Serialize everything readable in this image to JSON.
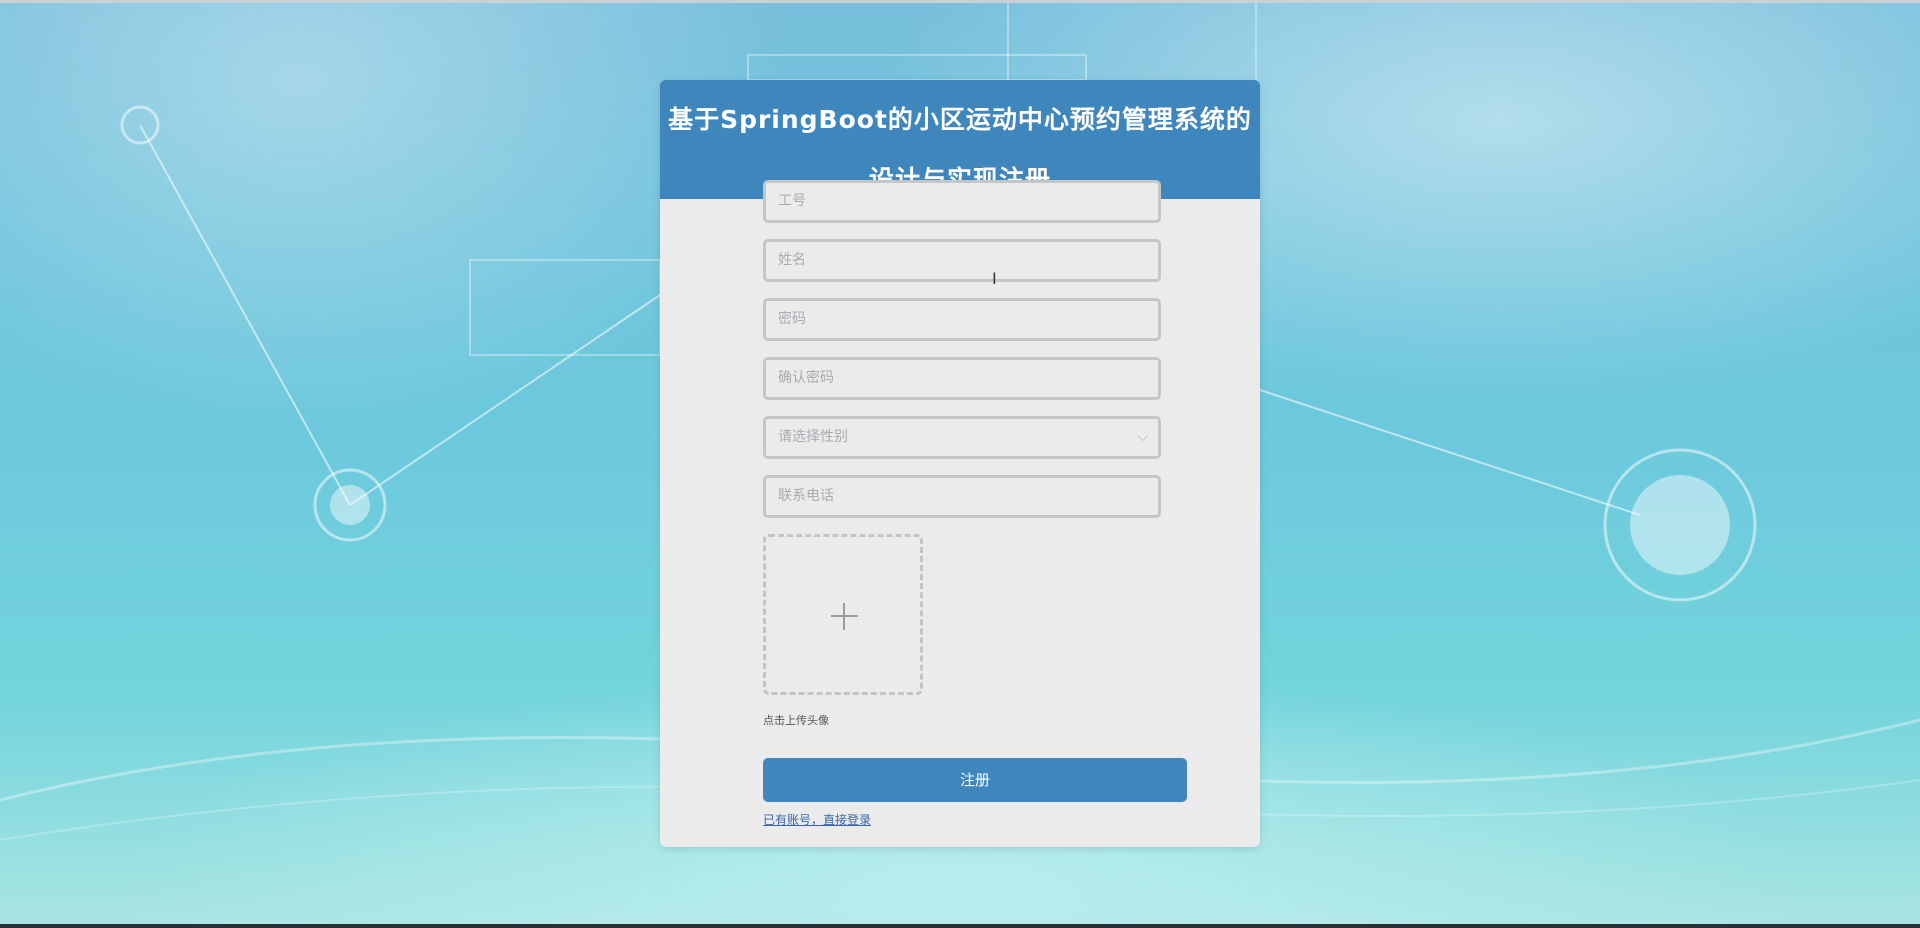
{
  "page": {
    "title_line1": "基于SpringBoot的小区运动中心预约管理系统的",
    "title_line2": "设计与实现注册"
  },
  "form": {
    "fields": [
      {
        "placeholder": "工号"
      },
      {
        "placeholder": "姓名"
      },
      {
        "placeholder": "密码"
      },
      {
        "placeholder": "确认密码"
      },
      {
        "placeholder": "请选择性别",
        "type": "select"
      },
      {
        "placeholder": "联系电话"
      }
    ],
    "upload_label": "点击上传头像",
    "submit_label": "注册",
    "login_link": "已有账号，直接登录"
  },
  "icons": {
    "plus": "plus-icon",
    "chevron": "chevron-down-icon",
    "cursor": "text-cursor-icon"
  },
  "colors": {
    "accent": "#3f86bc",
    "card_bg": "#ebebeb",
    "link": "#3a66a8"
  }
}
